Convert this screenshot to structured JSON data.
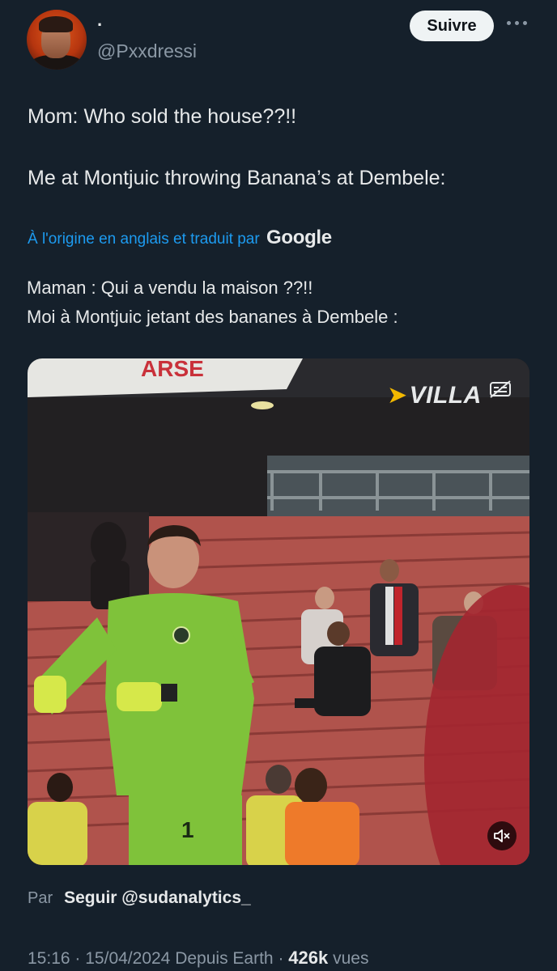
{
  "author": {
    "display_name": "·",
    "handle": "@Pxxdressi",
    "follow_label": "Suivre"
  },
  "tweet": {
    "line1": "Mom: Who sold the house??!!",
    "line2": "Me at Montjuic throwing Banana’s at Dembele:"
  },
  "translation": {
    "note": "À l'origine en anglais et traduit par",
    "provider": "Google",
    "line1": "Maman : Qui a vendu la maison ??!!",
    "line2": "Moi à Montjuic jetant des bananes à Dembele :"
  },
  "media": {
    "watermark": "VILLA",
    "stadium_sign": "ARSE",
    "shirt_number": "1"
  },
  "attribution": {
    "prefix": "Par",
    "text": "Seguir @sudanalytics_"
  },
  "meta": {
    "time": "15:16",
    "date": "15/04/2024",
    "source": "Depuis Earth",
    "views_count": "426k",
    "views_label": "vues"
  },
  "colors": {
    "background": "#15202b",
    "link": "#1d9bf0",
    "muted": "#8b98a5",
    "text": "#e7e9ea"
  }
}
